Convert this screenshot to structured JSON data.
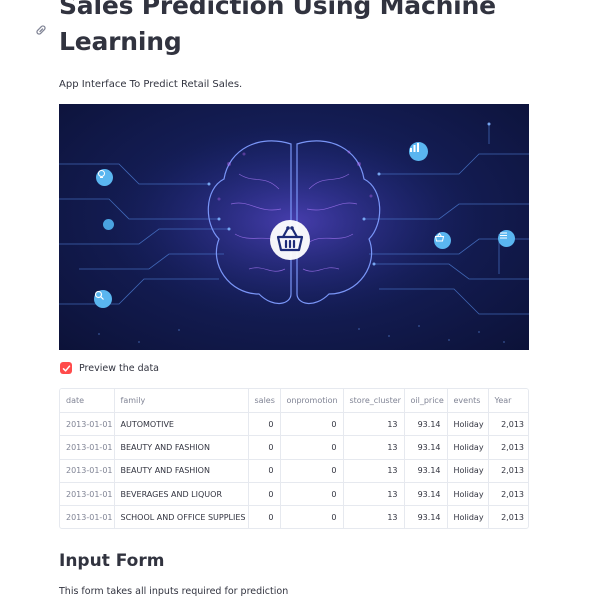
{
  "page": {
    "title": "Sales Prediction Using Machine Learning",
    "subtitle": "App Interface To Predict Retail Sales."
  },
  "hero": {
    "icons": [
      "lightbulb-icon",
      "search-icon",
      "chart-icon",
      "basket-icon",
      "list-icon"
    ]
  },
  "preview": {
    "checkbox_label": "Preview the data",
    "checked": true,
    "accent": "#ff4b4b"
  },
  "table": {
    "columns": [
      "date",
      "family",
      "sales",
      "onpromotion",
      "store_cluster",
      "oil_price",
      "events",
      "Year"
    ],
    "rows": [
      [
        "2013-01-01",
        "AUTOMOTIVE",
        "0",
        "0",
        "13",
        "93.14",
        "Holiday",
        "2,013"
      ],
      [
        "2013-01-01",
        "BEAUTY AND FASHION",
        "0",
        "0",
        "13",
        "93.14",
        "Holiday",
        "2,013"
      ],
      [
        "2013-01-01",
        "BEAUTY AND FASHION",
        "0",
        "0",
        "13",
        "93.14",
        "Holiday",
        "2,013"
      ],
      [
        "2013-01-01",
        "BEVERAGES AND LIQUOR",
        "0",
        "0",
        "13",
        "93.14",
        "Holiday",
        "2,013"
      ],
      [
        "2013-01-01",
        "SCHOOL AND OFFICE SUPPLIES",
        "0",
        "0",
        "13",
        "93.14",
        "Holiday",
        "2,013"
      ]
    ]
  },
  "input_form": {
    "title": "Input Form",
    "description": "This form takes all inputs required for prediction"
  }
}
